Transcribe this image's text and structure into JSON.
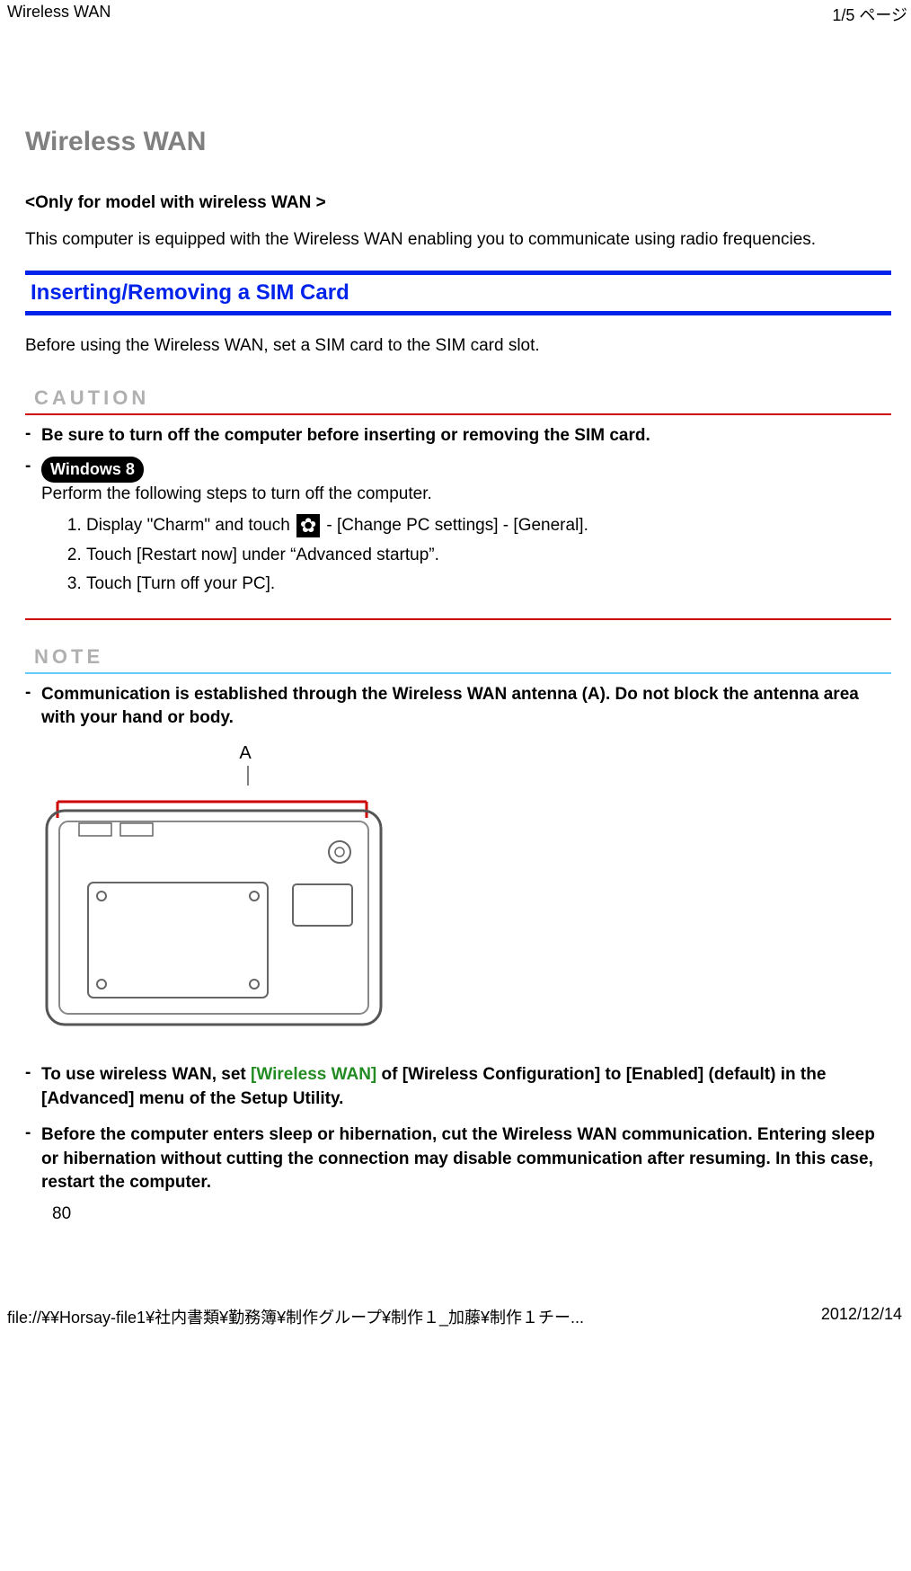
{
  "header": {
    "left": "Wireless WAN",
    "right": "1/5 ページ"
  },
  "title": "Wireless WAN",
  "sub1": "<Only for model with wireless WAN >",
  "intro": "This computer is equipped with the Wireless WAN enabling you to communicate using radio frequencies.",
  "section1": "Inserting/Removing a SIM Card",
  "before_text": "Before using the Wireless WAN, set a SIM card to the SIM card slot.",
  "caution_label": "CAUTION",
  "caution_b1": "Be sure to turn off the computer before inserting or removing the SIM card.",
  "win8_badge": "Windows 8",
  "caution_perform": "Perform the following steps to turn off the computer.",
  "steps": {
    "s1a": "Display \"Charm\" and touch ",
    "s1b": " - [Change PC settings] - [General].",
    "s2": "Touch [Restart now] under “Advanced startup”.",
    "s3": "Touch [Turn off your PC]."
  },
  "note_label": "NOTE",
  "note_b1": "Communication is established through the Wireless WAN antenna (A). Do not block the antenna area with your hand or body.",
  "fig_label": "A",
  "note_b2a": "To use wireless WAN, set ",
  "note_b2_link": "[Wireless WAN]",
  "note_b2b": " of [Wireless Configuration] to [Enabled] (default) in the [Advanced] menu of the Setup Utility.",
  "note_b3": "Before the computer enters sleep or hibernation, cut the Wireless WAN communication. Entering sleep or hibernation without cutting the connection may disable communication after resuming. In this case, restart the computer.",
  "page_number": "80",
  "footer": {
    "left": "file://¥¥Horsay-file1¥社内書類¥勤務簿¥制作グループ¥制作１_加藤¥制作１チー...",
    "right": "2012/12/14"
  }
}
